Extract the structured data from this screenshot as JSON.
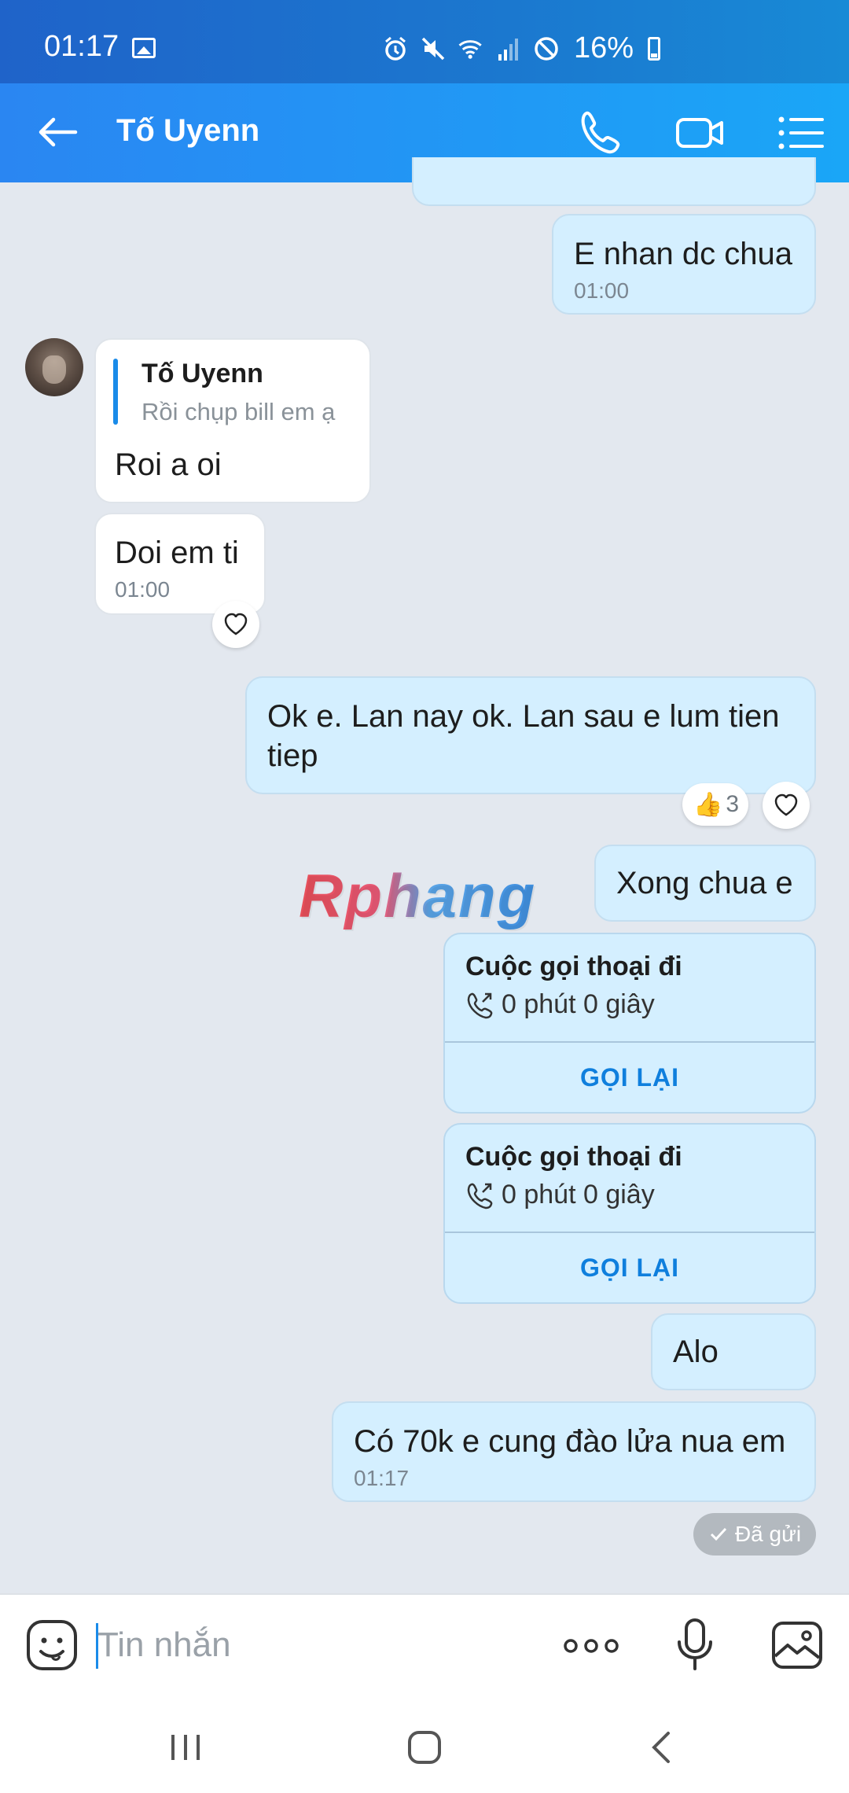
{
  "status_bar": {
    "time": "01:17",
    "battery": "16%"
  },
  "header": {
    "contact_name": "Tố Uyenn"
  },
  "messages": {
    "m1": {
      "text": "E nhan dc chua",
      "time": "01:00"
    },
    "m2": {
      "reply_name": "Tố Uyenn",
      "reply_snippet": "Rồi chụp bill em ạ",
      "text": "Roi a oi"
    },
    "m3": {
      "text": "Doi em ti",
      "time": "01:00"
    },
    "m4": {
      "line1": "Ok e. Lan nay ok. Lan sau e lum tien",
      "line2": "tiep",
      "reaction_emoji": "👍",
      "reaction_count": "3"
    },
    "m5": {
      "text": "Xong chua e"
    },
    "call1": {
      "title": "Cuộc gọi thoại đi",
      "duration": "0 phút 0 giây",
      "recall": "GỌI LẠI"
    },
    "call2": {
      "title": "Cuộc gọi thoại đi",
      "duration": "0 phút 0 giây",
      "recall": "GỌI LẠI"
    },
    "m6": {
      "text": "Alo"
    },
    "m7": {
      "text": "Có 70k e cung đào lửa nua em",
      "time": "01:17"
    }
  },
  "sent_status": "Đã gửi",
  "watermark": "Rphang",
  "composer": {
    "placeholder": "Tin nhắn"
  },
  "colors": {
    "header_blue": "#2a86f2",
    "outgoing_bubble": "#d4efff",
    "incoming_bubble": "#ffffff",
    "recall_blue": "#0f7fdd"
  },
  "icons": [
    "back-arrow-icon",
    "phone-icon",
    "video-call-icon",
    "list-menu-icon",
    "heart-icon",
    "call-out-icon",
    "check-icon",
    "emoji-icon",
    "more-icon",
    "microphone-icon",
    "gallery-icon"
  ]
}
